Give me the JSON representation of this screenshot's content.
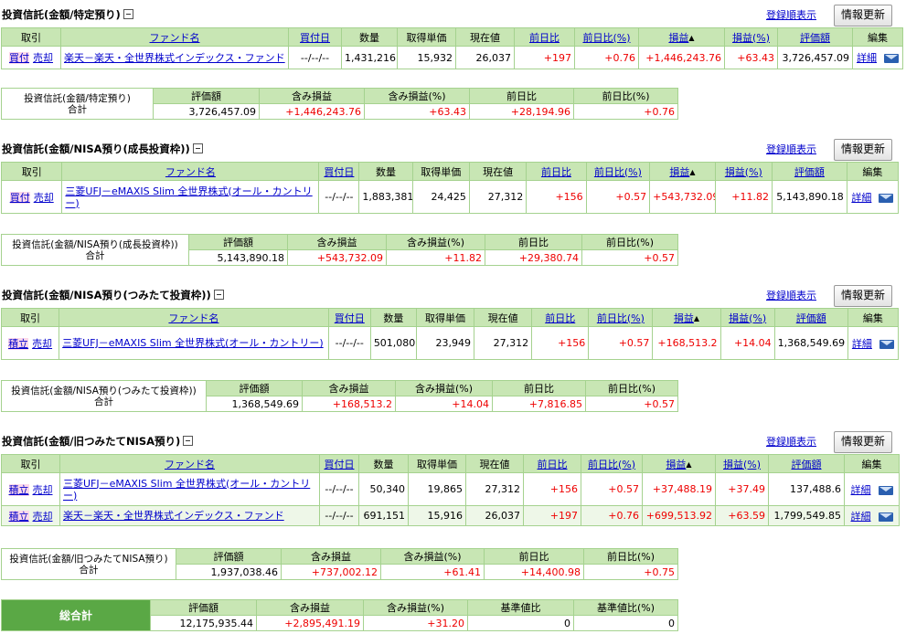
{
  "common": {
    "order_label": "登録順表示",
    "refresh_label": "情報更新",
    "detail_label": "詳細",
    "headers": [
      "取引",
      "ファンド名",
      "買付日",
      "数量",
      "取得単価",
      "現在値",
      "前日比",
      "前日比(%)",
      "損益",
      "損益(%)",
      "評価額",
      "編集"
    ],
    "sum_headers": [
      "評価額",
      "含み損益",
      "含み損益(%)",
      "前日比",
      "前日比(%)"
    ],
    "total_label": "合計"
  },
  "sections": [
    {
      "title": "投資信託(金額/特定預り)",
      "rows": [
        {
          "t1": "買付",
          "t2": "売却",
          "name": "楽天－楽天・全世界株式インデックス・ファンド",
          "date": "--/--/--",
          "qty": "1,431,216",
          "cost": "15,932",
          "price": "26,037",
          "chg": "+197",
          "chgp": "+0.76",
          "pl": "+1,446,243.76",
          "plp": "+63.43",
          "val": "3,726,457.09"
        }
      ],
      "summary": {
        "label": "投資信託(金額/特定預り)",
        "val": "3,726,457.09",
        "pl": "+1,446,243.76",
        "plp": "+63.43",
        "chg": "+28,194.96",
        "chgp": "+0.76"
      }
    },
    {
      "title": "投資信託(金額/NISA預り(成長投資枠))",
      "rows": [
        {
          "t1": "買付",
          "t2": "売却",
          "name": "三菱UFJ－eMAXIS Slim 全世界株式(オール・カントリー)",
          "date": "--/--/--",
          "qty": "1,883,381",
          "cost": "24,425",
          "price": "27,312",
          "chg": "+156",
          "chgp": "+0.57",
          "pl": "+543,732.09",
          "plp": "+11.82",
          "val": "5,143,890.18"
        }
      ],
      "summary": {
        "label": "投資信託(金額/NISA預り(成長投資枠))",
        "val": "5,143,890.18",
        "pl": "+543,732.09",
        "plp": "+11.82",
        "chg": "+29,380.74",
        "chgp": "+0.57"
      }
    },
    {
      "title": "投資信託(金額/NISA預り(つみたて投資枠))",
      "rows": [
        {
          "t1": "積立",
          "t2": "売却",
          "name": "三菱UFJ－eMAXIS Slim 全世界株式(オール・カントリー)",
          "date": "--/--/--",
          "qty": "501,080",
          "cost": "23,949",
          "price": "27,312",
          "chg": "+156",
          "chgp": "+0.57",
          "pl": "+168,513.2",
          "plp": "+14.04",
          "val": "1,368,549.69"
        }
      ],
      "summary": {
        "label": "投資信託(金額/NISA預り(つみたて投資枠))",
        "val": "1,368,549.69",
        "pl": "+168,513.2",
        "plp": "+14.04",
        "chg": "+7,816.85",
        "chgp": "+0.57"
      }
    },
    {
      "title": "投資信託(金額/旧つみたてNISA預り)",
      "rows": [
        {
          "t1": "積立",
          "t2": "売却",
          "name": "三菱UFJ－eMAXIS Slim 全世界株式(オール・カントリー)",
          "date": "--/--/--",
          "qty": "50,340",
          "cost": "19,865",
          "price": "27,312",
          "chg": "+156",
          "chgp": "+0.57",
          "pl": "+37,488.19",
          "plp": "+37.49",
          "val": "137,488.6"
        },
        {
          "t1": "積立",
          "t2": "売却",
          "name": "楽天－楽天・全世界株式インデックス・ファンド",
          "date": "--/--/--",
          "qty": "691,151",
          "cost": "15,916",
          "price": "26,037",
          "chg": "+197",
          "chgp": "+0.76",
          "pl": "+699,513.92",
          "plp": "+63.59",
          "val": "1,799,549.85"
        }
      ],
      "summary": {
        "label": "投資信託(金額/旧つみたてNISA預り)",
        "val": "1,937,038.46",
        "pl": "+737,002.12",
        "plp": "+61.41",
        "chg": "+14,400.98",
        "chgp": "+0.75"
      }
    }
  ],
  "grand_total": {
    "label": "総合計",
    "headers": [
      "評価額",
      "含み損益",
      "含み損益(%)",
      "基準値比",
      "基準値比(%)"
    ],
    "val": "12,175,935.44",
    "pl": "+2,895,491.19",
    "plp": "+31.20",
    "base": "0",
    "basep": "0"
  }
}
